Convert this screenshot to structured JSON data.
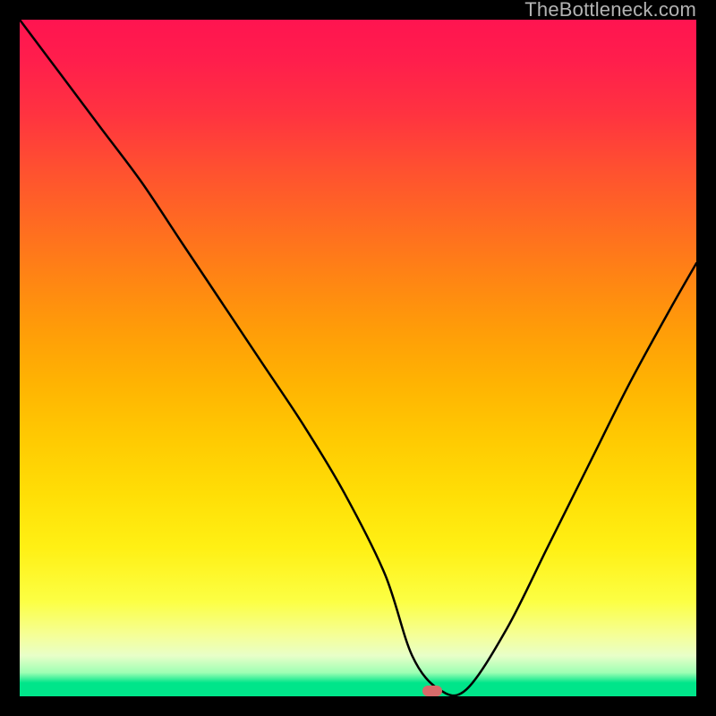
{
  "watermark": {
    "text": "TheBottleneck.com"
  },
  "marker": {
    "left_pct": 61,
    "top_pct": 99.2
  },
  "chart_data": {
    "type": "line",
    "title": "",
    "xlabel": "",
    "ylabel": "",
    "xlim": [
      0,
      100
    ],
    "ylim": [
      0,
      100
    ],
    "grid": false,
    "legend": false,
    "background": "red-to-green vertical gradient (bottleneck severity heatmap)",
    "annotations": [
      {
        "kind": "marker",
        "shape": "pill",
        "color": "#d86a6a",
        "x": 61,
        "y": 0.8
      }
    ],
    "series": [
      {
        "name": "bottleneck-curve",
        "x": [
          0,
          6,
          12,
          18,
          24,
          30,
          36,
          42,
          48,
          54,
          58,
          62,
          66,
          72,
          78,
          84,
          90,
          96,
          100
        ],
        "y": [
          100,
          92,
          84,
          76,
          67,
          58,
          49,
          40,
          30,
          18,
          6,
          1,
          1,
          10,
          22,
          34,
          46,
          57,
          64
        ]
      }
    ]
  }
}
